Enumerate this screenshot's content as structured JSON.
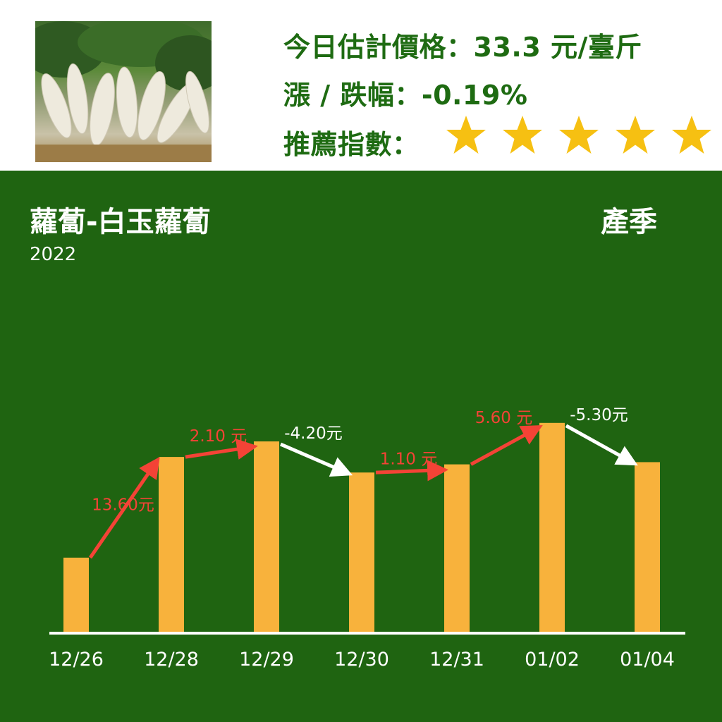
{
  "header": {
    "price_label": "今日估計價格：",
    "price_value": "33.3 元/臺斤",
    "change_label": "漲 / 跌幅：",
    "change_value": "-0.19%",
    "rating_label": "推薦指數："
  },
  "rating": {
    "stars": 5,
    "max": 5,
    "star_color": "#f6c012"
  },
  "image": {
    "icon": "white-radish-photo"
  },
  "chart_data": {
    "type": "bar",
    "title": "蘿蔔-白玉蘿蔔",
    "season": "產季",
    "year": "2022",
    "categories": [
      "12/26",
      "12/28",
      "12/29",
      "12/30",
      "12/31",
      "01/02",
      "01/04"
    ],
    "values": [
      20.2,
      33.8,
      35.9,
      31.7,
      32.8,
      38.4,
      33.1
    ],
    "ylim": [
      10,
      42
    ],
    "changes": [
      {
        "label": "13.60元",
        "direction": "up"
      },
      {
        "label": "2.10 元",
        "direction": "up"
      },
      {
        "label": "-4.20元",
        "direction": "down"
      },
      {
        "label": "1.10 元",
        "direction": "up"
      },
      {
        "label": "5.60 元",
        "direction": "up"
      },
      {
        "label": "-5.30元",
        "direction": "down"
      }
    ],
    "colors": {
      "bar": "#f8b23c",
      "up": "#f44336",
      "down": "#ffffff",
      "axis": "#ffffff",
      "background": "#1f6411"
    }
  }
}
